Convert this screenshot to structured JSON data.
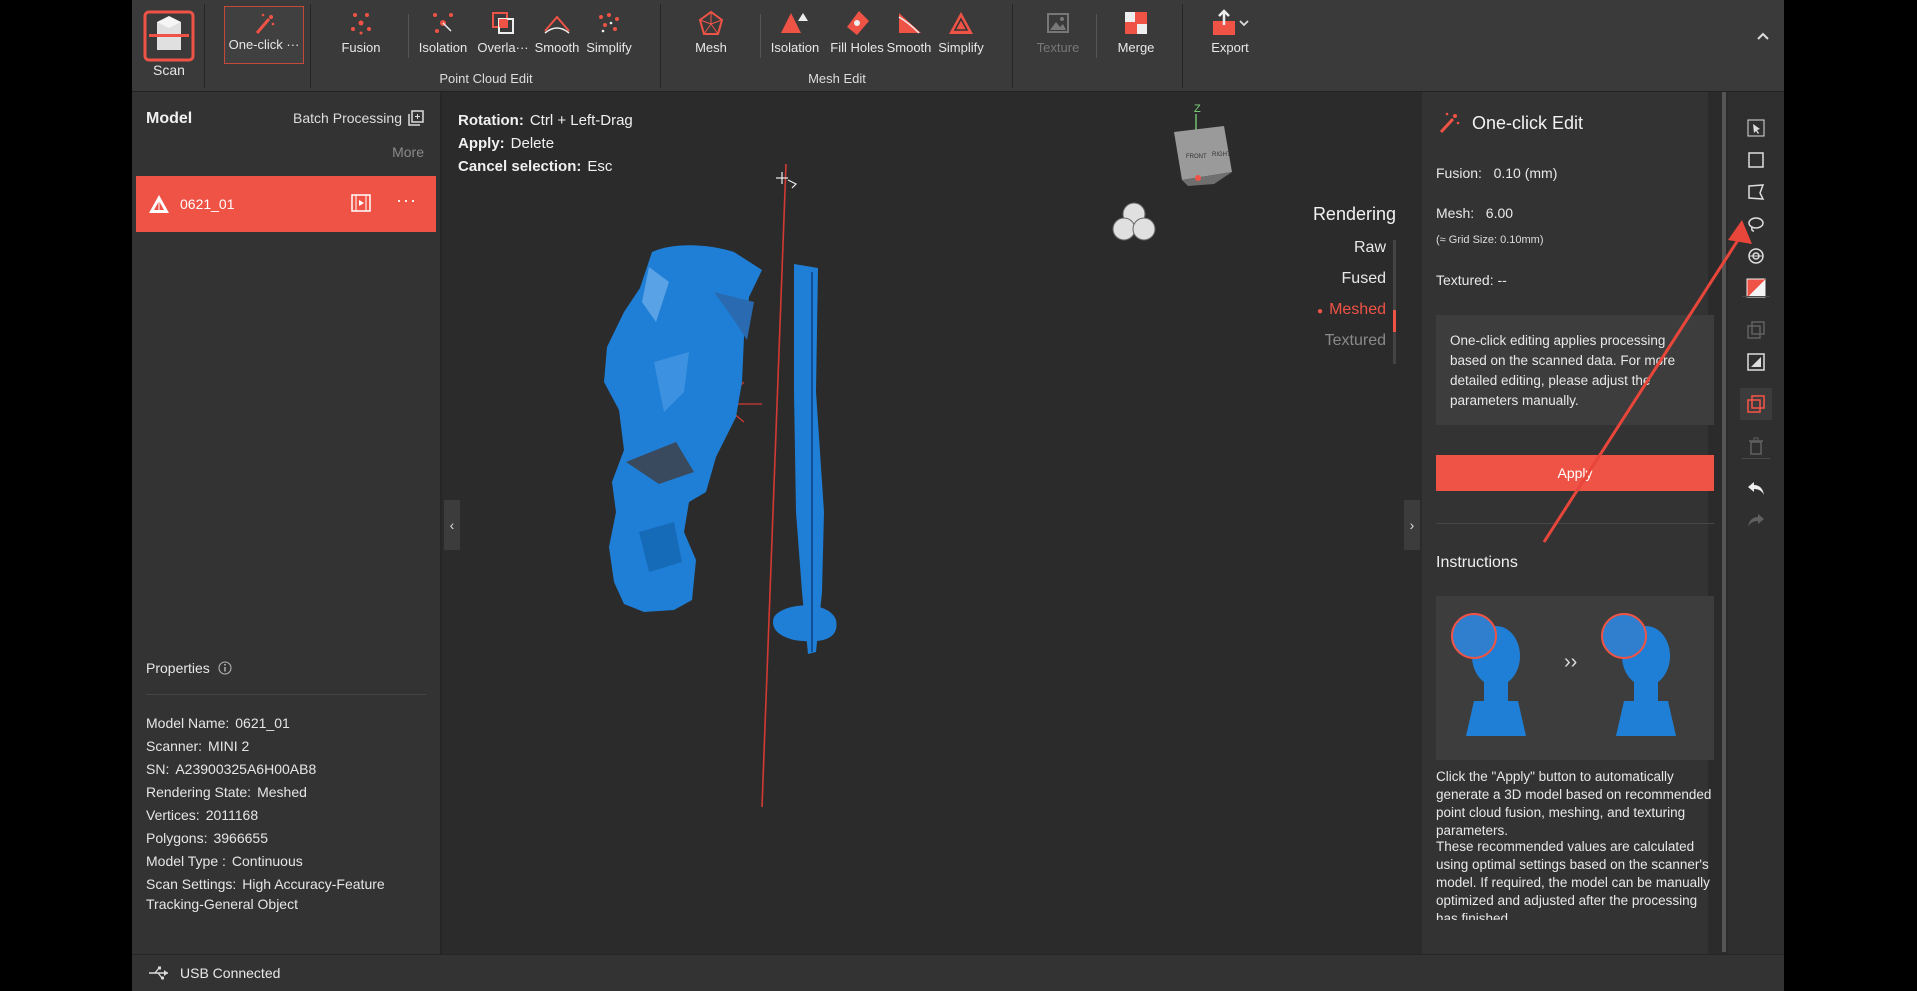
{
  "toolbar": {
    "scan": "Scan",
    "one_click": "One-click ···",
    "point_cloud_group": "Point Cloud Edit",
    "point_cloud_tools": [
      "Fusion",
      "Isolation",
      "Overla···",
      "Smooth",
      "Simplify"
    ],
    "mesh_group": "Mesh Edit",
    "mesh_tools": [
      "Mesh",
      "Isolation",
      "Fill Holes",
      "Smooth",
      "Simplify"
    ],
    "texture": "Texture",
    "merge": "Merge",
    "export": "Export"
  },
  "left_panel": {
    "title": "Model",
    "batch": "Batch Processing",
    "more": "More",
    "model_name": "0621_01",
    "properties_title": "Properties",
    "properties": [
      {
        "key": "Model Name:",
        "value": "0621_01"
      },
      {
        "key": "Scanner:",
        "value": "MINI 2"
      },
      {
        "key": "SN:",
        "value": "A23900325A6H00AB8"
      },
      {
        "key": "Rendering State:",
        "value": "Meshed"
      },
      {
        "key": "Vertices:",
        "value": "2011168"
      },
      {
        "key": "Polygons:",
        "value": "3966655"
      },
      {
        "key": "Model Type :",
        "value": "Continuous"
      },
      {
        "key": "Scan Settings:",
        "value": "High Accuracy-Feature"
      }
    ],
    "scan_settings_cont": "Tracking-General Object"
  },
  "viewport": {
    "hints": [
      {
        "k": "Rotation:",
        "v": "Ctrl + Left-Drag"
      },
      {
        "k": "Apply:",
        "v": "Delete"
      },
      {
        "k": "Cancel selection:",
        "v": "Esc"
      }
    ],
    "rendering_title": "Rendering",
    "rendering_options": [
      "Raw",
      "Fused",
      "Meshed",
      "Textured"
    ],
    "active_option": "Meshed",
    "axis_z": "Z",
    "cube_front": "FRONT",
    "cube_right": "RIGHT"
  },
  "right_panel": {
    "title": "One-click Edit",
    "fusion_label": "Fusion:",
    "fusion_value": "0.10 (mm)",
    "mesh_label": "Mesh:",
    "mesh_value": "6.00",
    "grid_size": "(≈ Grid Size: 0.10mm)",
    "textured_label": "Textured:",
    "textured_value": "--",
    "note": "One-click editing applies processing based on the scanned data. For more detailed editing, please adjust the parameters manually.",
    "apply": "Apply",
    "instructions_title": "Instructions",
    "para1": "Click the \"Apply\" button to automatically generate a 3D model based on recommended point cloud fusion, meshing, and texturing parameters.",
    "para2": "These recommended values are calculated using optimal settings based on the scanner's model. If required, the model can be manually optimized and adjusted after the processing has finished."
  },
  "status": {
    "text": "USB Connected"
  },
  "colors": {
    "accent": "#ef5346",
    "model_blue": "#1f7fd6"
  }
}
